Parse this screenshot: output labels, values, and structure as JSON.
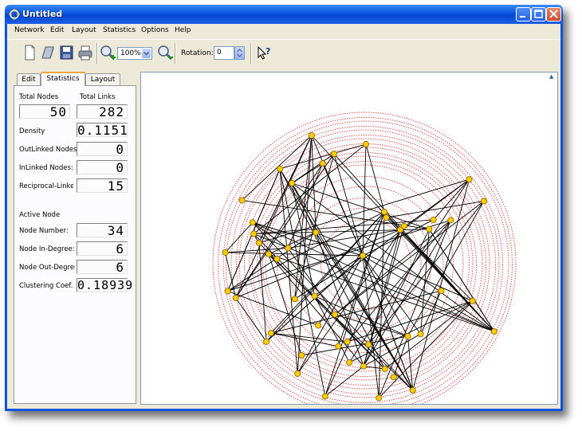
{
  "window": {
    "title": "Untitled"
  },
  "menu": [
    "Network",
    "Edit",
    "Layout",
    "Statistics",
    "Options",
    "Help"
  ],
  "toolbar": {
    "zoom_value": "100%",
    "rotation_label": "Rotation:",
    "rotation_value": "0",
    "icons": [
      "new-icon",
      "open-icon",
      "save-icon",
      "print-icon",
      "zoom-in-icon",
      "zoom-out-icon",
      "help-pointer-icon"
    ]
  },
  "tabs": [
    "Edit",
    "Statistics",
    "Layout"
  ],
  "stats": {
    "total_nodes_label": "Total Nodes",
    "total_links_label": "Total Links",
    "total_nodes": "50",
    "total_links": "282",
    "density_label": "Density",
    "density": "0.1151",
    "outlinked_label": "OutLinked Nodes",
    "outlinked": "0",
    "inlinked_label": "InLinked Nodes:",
    "inlinked": "0",
    "reciprocal_label": "Reciprocal-Linked",
    "reciprocal": "15",
    "active_node_label": "Active Node",
    "node_number_label": "Node Number:",
    "node_number": "34",
    "in_degree_label": "Node In-Degree:",
    "in_degree": "6",
    "out_degree_label": "Node Out-Degree",
    "out_degree": "6",
    "clustering_label": "Clustering Coef.",
    "clustering": "0.18939"
  },
  "colors": {
    "titlebar": "#0a55e0",
    "frame": "#ece9d8",
    "ring": "#e02020",
    "node": "#ffcc00",
    "edge": "#000000"
  }
}
